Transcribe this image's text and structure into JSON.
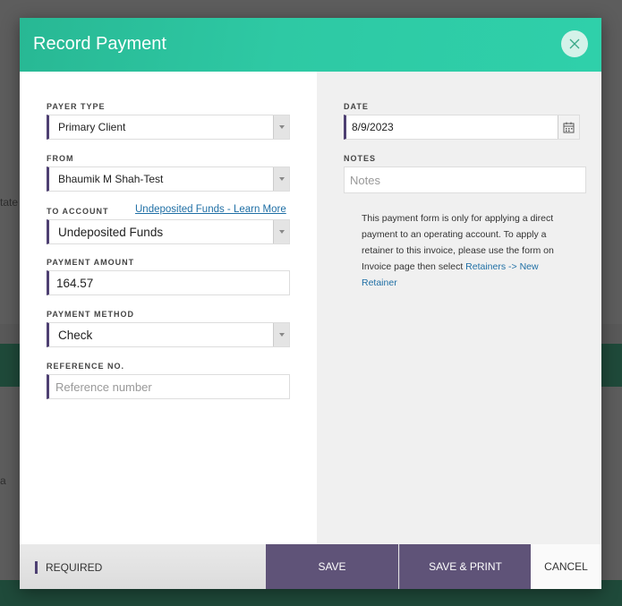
{
  "background": {
    "fragments": [
      "tate",
      "a"
    ]
  },
  "modal": {
    "title": "Record Payment",
    "close_icon": "close-icon",
    "payer_type": {
      "label": "PAYER TYPE",
      "value": "Primary Client"
    },
    "from": {
      "label": "FROM",
      "value": "Bhaumik M Shah-Test"
    },
    "to_account": {
      "label": "TO ACCOUNT",
      "link": "Undeposited Funds - Learn More",
      "value": "Undeposited Funds"
    },
    "payment_amount": {
      "label": "PAYMENT AMOUNT",
      "value": "164.57"
    },
    "payment_method": {
      "label": "PAYMENT METHOD",
      "value": "Check"
    },
    "reference_no": {
      "label": "REFERENCE NO.",
      "placeholder": "Reference number"
    },
    "date": {
      "label": "DATE",
      "value": "8/9/2023",
      "icon": "calendar-icon"
    },
    "notes": {
      "label": "NOTES",
      "placeholder": "Notes"
    },
    "info": {
      "text": "This payment form is only for applying a direct payment to an operating account. To apply a retainer to this invoice, please use the form on Invoice page then select",
      "link": "Retainers -> New Retainer"
    }
  },
  "footer": {
    "required_label": "REQUIRED",
    "save_label": "SAVE",
    "save_print_label": "SAVE & PRINT",
    "cancel_label": "CANCEL"
  },
  "colors": {
    "header": "#2ec9a4",
    "accent": "#4e4072",
    "button": "#5f5378",
    "link": "#1f6fa5"
  }
}
